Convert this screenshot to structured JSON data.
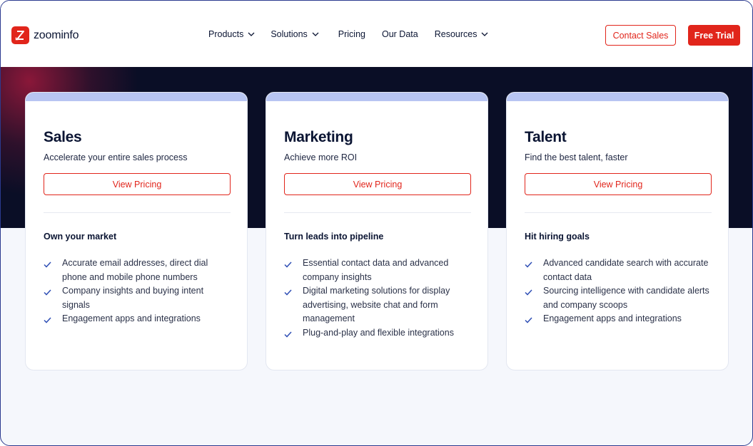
{
  "brand": {
    "name": "zoominfo",
    "accent": "#e1251b",
    "navy": "#0b1533",
    "card_top": "#b8c5f2"
  },
  "nav": {
    "items": [
      {
        "label": "Products",
        "has_dropdown": true
      },
      {
        "label": "Solutions",
        "has_dropdown": true
      },
      {
        "label": "Pricing",
        "has_dropdown": false
      },
      {
        "label": "Our Data",
        "has_dropdown": false
      },
      {
        "label": "Resources",
        "has_dropdown": true
      }
    ],
    "contact_label": "Contact Sales",
    "trial_label": "Free Trial"
  },
  "cards": [
    {
      "title": "Sales",
      "subtitle": "Accelerate your entire sales process",
      "button_label": "View Pricing",
      "heading": "Own your market",
      "features": [
        "Accurate email addresses, direct dial phone and mobile phone numbers",
        "Company insights and buying intent signals",
        "Engagement apps and integrations"
      ]
    },
    {
      "title": "Marketing",
      "subtitle": "Achieve more ROI",
      "button_label": "View Pricing",
      "heading": "Turn leads into pipeline",
      "features": [
        "Essential contact data and advanced company insights",
        "Digital marketing solutions for display advertising, website chat and form management",
        "Plug-and-play and flexible integrations"
      ]
    },
    {
      "title": "Talent",
      "subtitle": "Find the best talent, faster",
      "button_label": "View Pricing",
      "heading": "Hit hiring goals",
      "features": [
        "Advanced candidate search with accurate contact data",
        "Sourcing intelligence with candidate alerts and company scoops",
        "Engagement apps and integrations"
      ]
    }
  ]
}
